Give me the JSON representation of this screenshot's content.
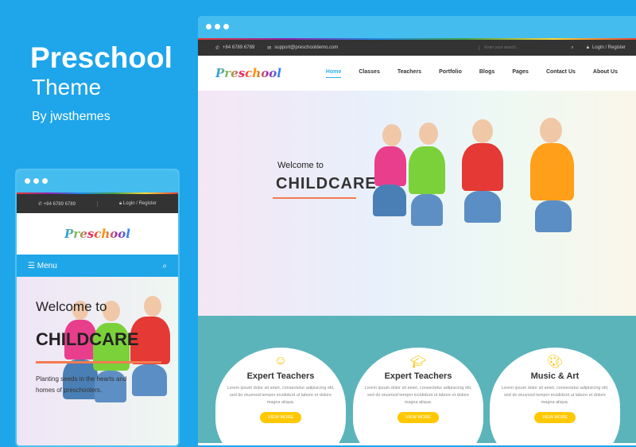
{
  "promo": {
    "title": "Preschool",
    "subtitle": "Theme",
    "by": "By jwsthemes"
  },
  "desktop": {
    "topbar": {
      "phone": "+84 6789 6789",
      "email": "support@preschooldemo.com",
      "search_placeholder": "Enter your search...",
      "login": "Login / Register"
    },
    "logo": "Preschool",
    "menu": [
      "Home",
      "Classes",
      "Teachers",
      "Portfolio",
      "Blogs",
      "Pages",
      "Contact Us",
      "About Us"
    ],
    "active_menu": "Home",
    "hero": {
      "welcome": "Welcome to",
      "headline": "CHILDCARE"
    },
    "cards": [
      {
        "icon": "teacher-icon",
        "title": "Expert Teachers",
        "text": "Lorem ipsum dolor sit amet, consectetur adipisicing elit, sed do eiusmod tempor incididunt ut labore et dolore magna aliqua.",
        "button": "VIEW MORE"
      },
      {
        "icon": "graduation-cap-icon",
        "title": "Expert Teachers",
        "text": "Lorem ipsum dolor sit amet, consectetur adipisicing elit, sed do eiusmod tempor incididunt ut labore et dolore magna aliqua.",
        "button": "VIEW MORE"
      },
      {
        "icon": "palette-icon",
        "title": "Music & Art",
        "text": "Lorem ipsum dolor sit amet, consectetur adipisicing elit, sed do eiusmod tempor incididunt ut labore et dolore magna aliqua.",
        "button": "VIEW MORE"
      }
    ]
  },
  "mobile": {
    "phone": "+84 6789 6789",
    "login": "Login / Register",
    "logo": "Preschool",
    "menu": "Menu",
    "hero": {
      "welcome": "Welcome to",
      "headline": "CHILDCARE",
      "tagline": "Planting seeds in the hearts and homes of preschoolers."
    }
  },
  "colors": {
    "background": "#1ea5ea",
    "accent": "#2fb0ee",
    "button": "#ffc800",
    "teal": "#5bb4ba",
    "underline": "#f47b4f"
  }
}
